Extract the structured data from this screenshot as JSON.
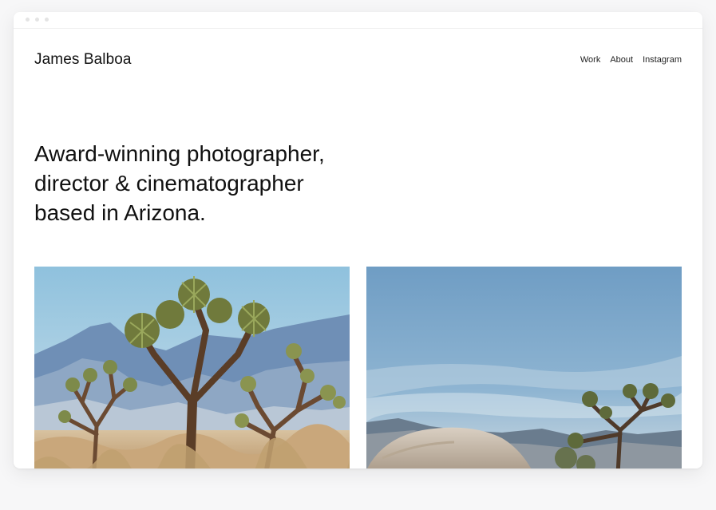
{
  "site": {
    "brand": "James Balboa",
    "nav": [
      {
        "label": "Work"
      },
      {
        "label": "About"
      },
      {
        "label": "Instagram"
      }
    ],
    "hero_lines": [
      "Award-winning photographer,",
      "director & cinematographer",
      "based in Arizona."
    ]
  },
  "photos": [
    {
      "subject": "joshua-trees-mountains"
    },
    {
      "subject": "joshua-tree-boulder-sky"
    }
  ],
  "colors": {
    "text": "#111111",
    "background": "#ffffff",
    "sky": "#a9cde0",
    "mountain": "#5f7ea8",
    "sand": "#c9a77b"
  }
}
